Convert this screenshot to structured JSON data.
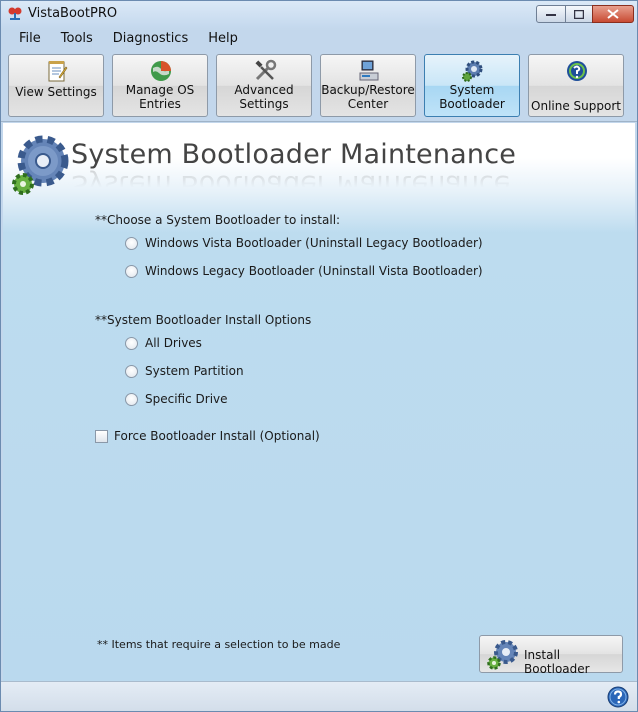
{
  "window": {
    "title": "VistaBootPRO",
    "icon": "app-tree-icon"
  },
  "menu": [
    "File",
    "Tools",
    "Diagnostics",
    "Help"
  ],
  "toolbar": {
    "view_settings": "View Settings",
    "manage_os_line1": "Manage OS",
    "manage_os_line2": "Entries",
    "advanced_line1": "Advanced",
    "advanced_line2": "Settings",
    "backup_line1": "Backup/Restore",
    "backup_line2": "Center",
    "system_line1": "System",
    "system_line2": "Bootloader",
    "online_support": "Online Support",
    "active": "System Bootloader"
  },
  "page": {
    "title": "System Bootloader Maintenance",
    "choose_label": "**Choose a System Bootloader to install:",
    "bootloader_options": [
      "Windows Vista Bootloader (Uninstall Legacy Bootloader)",
      "Windows Legacy Bootloader (Uninstall Vista Bootloader)"
    ],
    "install_options_label": "**System Bootloader Install Options",
    "install_options": [
      "All Drives",
      "System Partition",
      "Specific Drive"
    ],
    "force_label": "Force Bootloader Install (Optional)",
    "note": "** Items that require a selection to be made",
    "install_button": "Install Bootloader"
  },
  "colors": {
    "accent_blue": "#3c7fb1",
    "panel_blue": "#bad9ee"
  }
}
